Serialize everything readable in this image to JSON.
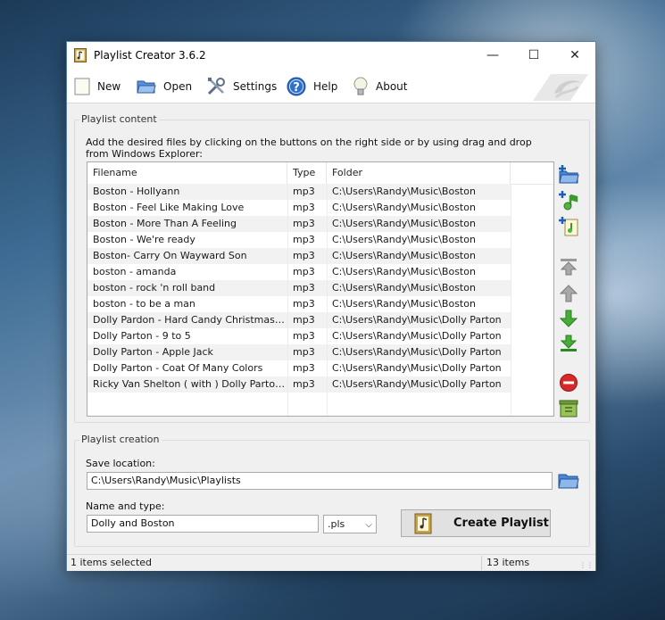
{
  "window": {
    "title": "Playlist Creator 3.6.2",
    "minimize": "—",
    "maximize": "☐",
    "close": "✕"
  },
  "toolbar": {
    "new": "New",
    "open": "Open",
    "settings": "Settings",
    "help": "Help",
    "about": "About"
  },
  "content": {
    "group_title": "Playlist content",
    "hint": "Add the desired files by clicking on the buttons on the right side or by using drag and drop from Windows Explorer:",
    "columns": [
      "Filename",
      "Type",
      "Folder"
    ],
    "rows": [
      {
        "filename": "Boston -  Hollyann",
        "type": "mp3",
        "folder": "C:\\Users\\Randy\\Music\\Boston"
      },
      {
        "filename": "Boston - Feel Like Making Love",
        "type": "mp3",
        "folder": "C:\\Users\\Randy\\Music\\Boston"
      },
      {
        "filename": "Boston - More Than A Feeling",
        "type": "mp3",
        "folder": "C:\\Users\\Randy\\Music\\Boston"
      },
      {
        "filename": "Boston - We're ready",
        "type": "mp3",
        "folder": "C:\\Users\\Randy\\Music\\Boston"
      },
      {
        "filename": "Boston- Carry On Wayward Son",
        "type": "mp3",
        "folder": "C:\\Users\\Randy\\Music\\Boston"
      },
      {
        "filename": "boston - amanda",
        "type": "mp3",
        "folder": "C:\\Users\\Randy\\Music\\Boston"
      },
      {
        "filename": "boston - rock 'n roll band",
        "type": "mp3",
        "folder": "C:\\Users\\Randy\\Music\\Boston"
      },
      {
        "filename": "boston - to be a man",
        "type": "mp3",
        "folder": "C:\\Users\\Randy\\Music\\Boston"
      },
      {
        "filename": "Dolly Pardon - Hard Candy Christmas (Bes...",
        "type": "mp3",
        "folder": "C:\\Users\\Randy\\Music\\Dolly Parton"
      },
      {
        "filename": "Dolly Parton - 9 to 5",
        "type": "mp3",
        "folder": "C:\\Users\\Randy\\Music\\Dolly Parton"
      },
      {
        "filename": "Dolly Parton - Apple Jack",
        "type": "mp3",
        "folder": "C:\\Users\\Randy\\Music\\Dolly Parton"
      },
      {
        "filename": "Dolly Parton - Coat Of Many Colors",
        "type": "mp3",
        "folder": "C:\\Users\\Randy\\Music\\Dolly Parton"
      },
      {
        "filename": "Ricky Van Shelton ( with ) Dolly Parton- R...",
        "type": "mp3",
        "folder": "C:\\Users\\Randy\\Music\\Dolly Parton"
      }
    ]
  },
  "creation": {
    "group_title": "Playlist creation",
    "save_label": "Save location:",
    "save_value": "C:\\Users\\Randy\\Music\\Playlists",
    "name_label": "Name and type:",
    "name_value": "Dolly and Boston",
    "type_value": ".pls",
    "create_label": "Create Playlist"
  },
  "status": {
    "selected": "1 items selected",
    "count": "13 items"
  },
  "colors": {
    "accent_blue": "#2f7fd0",
    "icon_green": "#3aa03a",
    "delete_red": "#d42a2a"
  },
  "icons": [
    "app-icon",
    "new-icon",
    "open-folder-icon",
    "settings-tools-icon",
    "help-icon",
    "lightbulb-icon",
    "add-folder-icon",
    "add-music-icon",
    "add-playlist-icon",
    "move-top-icon",
    "move-up-icon",
    "move-down-icon",
    "move-bottom-icon",
    "remove-icon",
    "clear-list-icon",
    "browse-folder-icon"
  ]
}
